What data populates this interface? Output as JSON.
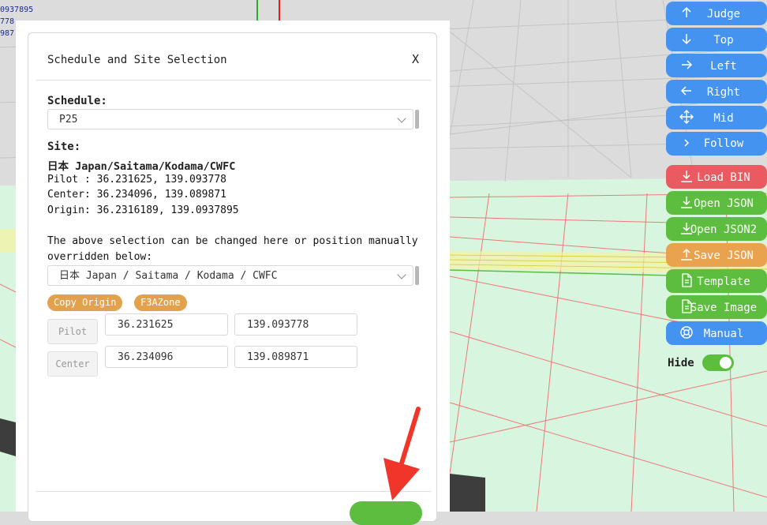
{
  "coords_overlay": [
    "0937895",
    "778",
    "987"
  ],
  "modal": {
    "title": "Schedule and Site Selection",
    "close": "X",
    "schedule_label": "Schedule:",
    "schedule_value": "P25",
    "site_label": "Site:",
    "site_name": "日本 Japan/Saitama/Kodama/CWFC",
    "pilot_line": "Pilot : 36.231625, 139.093778",
    "center_line": "Center: 36.234096, 139.089871",
    "origin_line": "Origin: 36.2316189, 139.0937895",
    "note_line1": "The above selection can be changed here or position manually",
    "note_line2": "overridden below:",
    "site_select_value": "日本 Japan / Saitama / Kodama / CWFC",
    "copy_origin": "Copy Origin",
    "f3azone": "F3AZone",
    "pilot_btn": "Pilot",
    "pilot_lat": "36.231625",
    "pilot_lon": "139.093778",
    "center_btn": "Center",
    "center_lat": "36.234096",
    "center_lon": "139.089871"
  },
  "panel": {
    "buttons": [
      {
        "label": "Judge",
        "icon": "arrow-up-icon"
      },
      {
        "label": "Top",
        "icon": "arrow-down-icon"
      },
      {
        "label": "Left",
        "icon": "arrow-right-icon"
      },
      {
        "label": "Right",
        "icon": "arrow-left-icon"
      },
      {
        "label": "Mid",
        "icon": "move-icon"
      },
      {
        "label": "Follow",
        "icon": "chevron-right-icon"
      },
      {
        "label": "Load BIN",
        "icon": "download-icon"
      },
      {
        "label": "Open JSON",
        "icon": "download-icon"
      },
      {
        "label": "Open JSON2",
        "icon": "download-icon"
      },
      {
        "label": "Save JSON",
        "icon": "upload-icon"
      },
      {
        "label": "Template",
        "icon": "file-icon"
      },
      {
        "label": "Save Image",
        "icon": "file-icon"
      },
      {
        "label": "Manual",
        "icon": "lifebuoy-icon"
      }
    ],
    "hide_label": "Hide",
    "hide_on": true
  },
  "colors": {
    "blue": "#4493f0",
    "red": "#ea5a61",
    "green": "#5cbd3e",
    "orange": "#e9a24e",
    "annotation_arrow": "#f0352b"
  }
}
